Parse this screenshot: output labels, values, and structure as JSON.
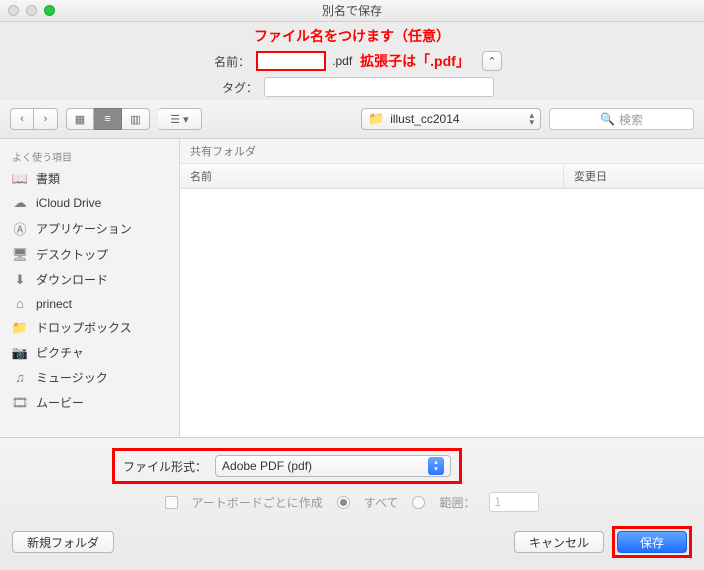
{
  "titlebar": {
    "title": "別名で保存"
  },
  "annotations": {
    "top": "ファイル名をつけます（任意）",
    "ext": "拡張子は「.pdf」"
  },
  "name": {
    "label": "名前：",
    "ext": ".pdf"
  },
  "tag": {
    "label": "タグ："
  },
  "toolbar": {
    "folder_name": "illust_cc2014",
    "search_placeholder": "検索"
  },
  "sidebar": {
    "heading": "よく使う項目",
    "items": [
      {
        "icon": "book-icon",
        "glyph": "📖",
        "label": "書類"
      },
      {
        "icon": "cloud-icon",
        "glyph": "☁︎",
        "label": "iCloud Drive"
      },
      {
        "icon": "apps-icon",
        "glyph": "Ⓐ",
        "label": "アプリケーション"
      },
      {
        "icon": "desktop-icon",
        "glyph": "🖥",
        "label": "デスクトップ"
      },
      {
        "icon": "download-icon",
        "glyph": "⬇",
        "label": "ダウンロード"
      },
      {
        "icon": "home-icon",
        "glyph": "⌂",
        "label": "prinect"
      },
      {
        "icon": "folder-icon",
        "glyph": "📁",
        "label": "ドロップボックス"
      },
      {
        "icon": "camera-icon",
        "glyph": "📷",
        "label": "ピクチャ"
      },
      {
        "icon": "music-icon",
        "glyph": "♫",
        "label": "ミュージック"
      },
      {
        "icon": "movie-icon",
        "glyph": "🎞",
        "label": "ムービー"
      }
    ]
  },
  "content": {
    "path_hint": "共有フォルダ",
    "col_name": "名前",
    "col_date": "変更日"
  },
  "format": {
    "label": "ファイル形式：",
    "selected": "Adobe PDF (pdf)"
  },
  "options": {
    "artboard": "アートボードごとに作成",
    "all": "すべて",
    "range": "範囲：",
    "range_value": "1"
  },
  "buttons": {
    "new_folder": "新規フォルダ",
    "cancel": "キャンセル",
    "save": "保存"
  }
}
